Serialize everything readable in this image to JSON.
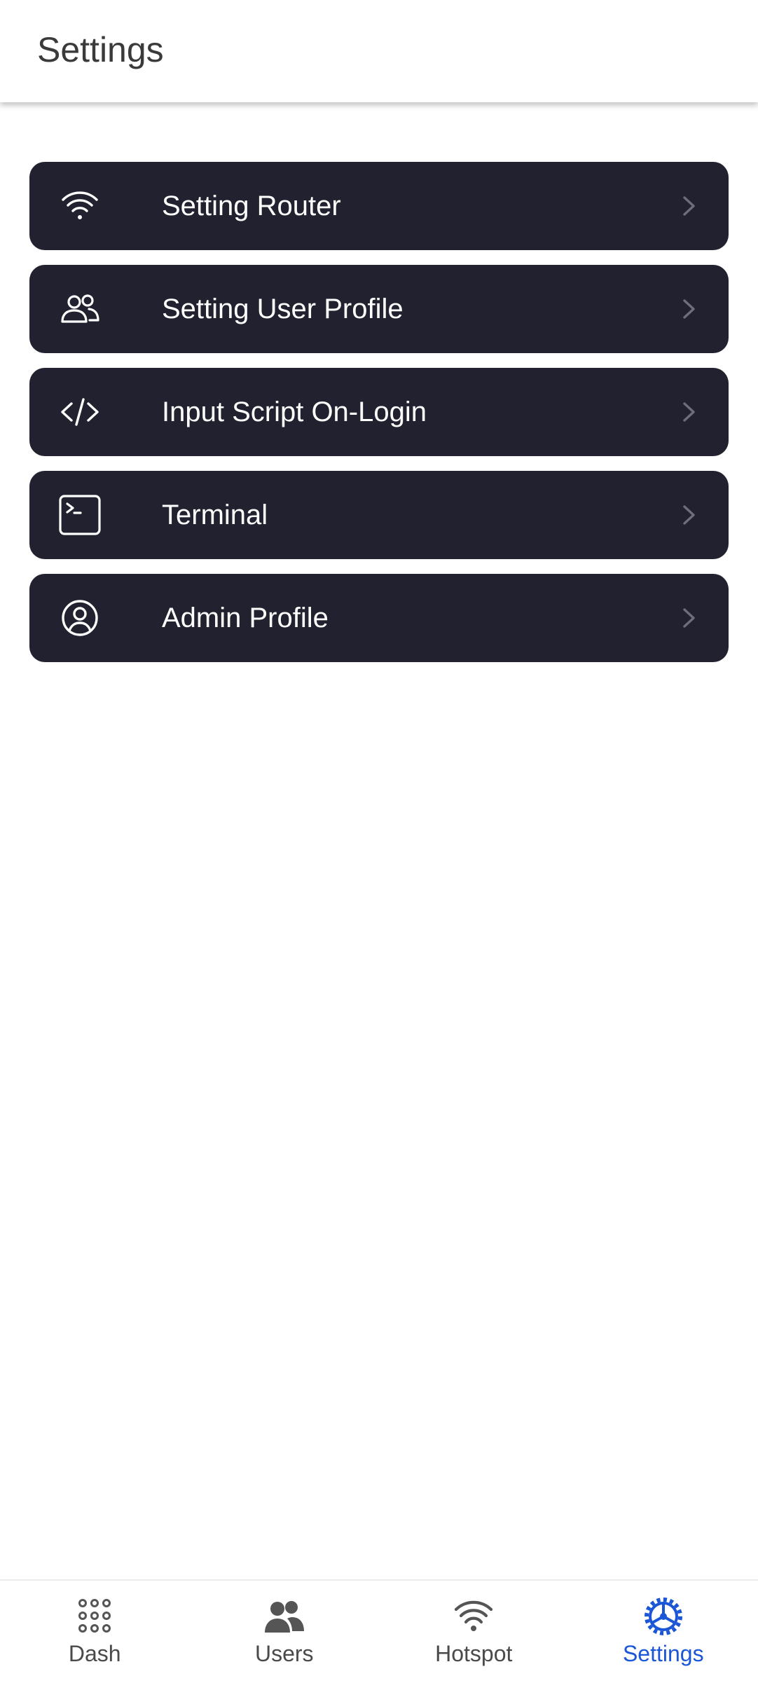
{
  "header": {
    "title": "Settings"
  },
  "menu": {
    "items": [
      {
        "label": "Setting Router",
        "icon": "wifi-icon"
      },
      {
        "label": "Setting User Profile",
        "icon": "users-icon"
      },
      {
        "label": "Input Script On-Login",
        "icon": "code-icon"
      },
      {
        "label": "Terminal",
        "icon": "terminal-icon"
      },
      {
        "label": "Admin Profile",
        "icon": "user-circle-icon"
      }
    ]
  },
  "bottom_nav": {
    "items": [
      {
        "label": "Dash",
        "icon": "grid-dots-icon",
        "active": false
      },
      {
        "label": "Users",
        "icon": "people-icon",
        "active": false
      },
      {
        "label": "Hotspot",
        "icon": "wifi-icon",
        "active": false
      },
      {
        "label": "Settings",
        "icon": "gear-icon",
        "active": true
      }
    ]
  },
  "colors": {
    "card_background": "#22212f",
    "card_text": "#ffffff",
    "chevron": "#6e6d7a",
    "nav_inactive": "#4a4a4a",
    "nav_active": "#1a56d6",
    "title_text": "#3a3a3a"
  }
}
